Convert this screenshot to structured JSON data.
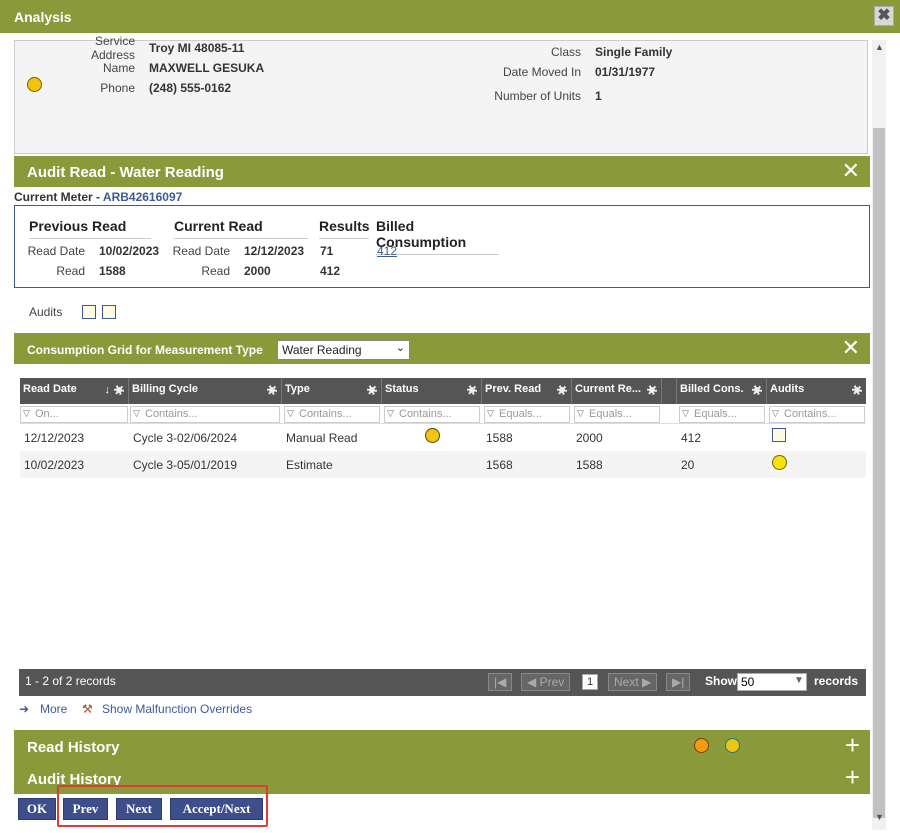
{
  "window": {
    "title": "Analysis",
    "close_glyph": "✖"
  },
  "customer": {
    "service_address_label": "Service Address",
    "service_address_value": "Troy MI 48085-11",
    "name_label": "Name",
    "name_value": "MAXWELL GESUKA",
    "phone_label": "Phone",
    "phone_value": "(248) 555-0162",
    "class_label": "Class",
    "class_value": "Single Family",
    "date_moved_label": "Date Moved In",
    "date_moved_value": "01/31/1977",
    "units_label": "Number of Units",
    "units_value": "1"
  },
  "audit_read": {
    "title": "Audit Read - Water Reading",
    "meter_label": "Current Meter - ",
    "meter_value": "ARB42616097",
    "previous": {
      "header": "Previous Read",
      "date_label": "Read Date",
      "date_value": "10/02/2023",
      "read_label": "Read",
      "read_value": "1588"
    },
    "current": {
      "header": "Current Read",
      "date_label": "Read Date",
      "date_value": "12/12/2023",
      "read_label": "Read",
      "read_value": "2000"
    },
    "results": {
      "header": "Results",
      "value1": "71",
      "value2": "412"
    },
    "billed": {
      "header": "Billed Consumption",
      "value": "412"
    },
    "audits_label": "Audits"
  },
  "consumption": {
    "title": "Consumption Grid for Measurement Type",
    "selected_type": "Water Reading",
    "columns": [
      "Read Date",
      "Billing Cycle",
      "Type",
      "Status",
      "Prev. Read",
      "Current Re...",
      "Billed Cons.",
      "Audits"
    ],
    "filters": [
      "On...",
      "Contains...",
      "Contains...",
      "Contains...",
      "Equals...",
      "Equals...",
      "Equals...",
      "Contains..."
    ],
    "rows": [
      {
        "read_date": "12/12/2023",
        "billing_cycle": "Cycle 3-02/06/2024",
        "type": "Manual Read",
        "prev": "1588",
        "current": "2000",
        "billed": "412"
      },
      {
        "read_date": "10/02/2023",
        "billing_cycle": "Cycle 3-05/01/2019",
        "type": "Estimate",
        "prev": "1568",
        "current": "1588",
        "billed": "20"
      }
    ],
    "pager": {
      "summary": "1 - 2 of 2 records",
      "first": "|◀",
      "prev": "◀  Prev",
      "page": "1",
      "next": "Next  ▶",
      "last": "▶|",
      "show_label": "Show",
      "page_size": "50",
      "records_label": "records"
    },
    "more_label": "More",
    "malfunction_label": "Show Malfunction Overrides"
  },
  "read_history": {
    "title": "Read History"
  },
  "audit_history": {
    "title": "Audit History"
  },
  "buttons": {
    "ok": "OK",
    "prev": "Prev",
    "next": "Next",
    "accept_next": "Accept/Next"
  },
  "glyphs": {
    "x": "✕",
    "plus": "+"
  },
  "colors": {
    "header_olive": "#8a9a3b",
    "button_navy": "#3d4e8b",
    "grid_header": "#555555",
    "link_blue": "#3d5a98",
    "highlight_red": "#e53935"
  }
}
